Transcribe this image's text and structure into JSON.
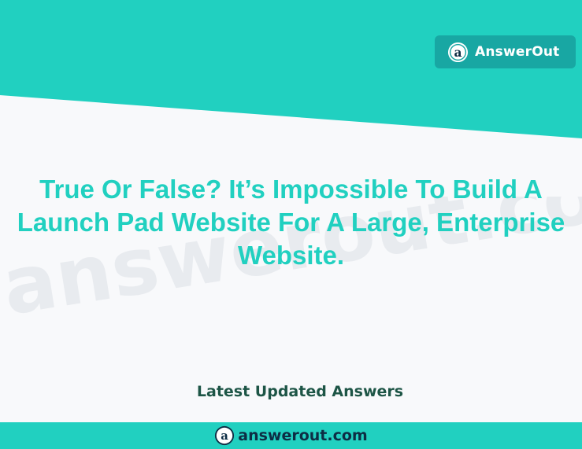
{
  "brand": {
    "name": "AnswerOut",
    "logo_icon": "answerout-a-logo-icon"
  },
  "headline": "True Or False? It’s Impossible To Build A Launch Pad Website For A Large, Enterprise Website.",
  "latest_label": "Latest Updated Answers",
  "footer": {
    "site": "answerout.com",
    "logo_icon": "answerout-a-logo-icon"
  },
  "watermark": "answerout.com",
  "colors": {
    "accent": "#21d0c0",
    "badge": "#18a7a3",
    "background": "#f8f9fb",
    "dark_text": "#1d5546",
    "footer_text": "#0d2d44"
  }
}
